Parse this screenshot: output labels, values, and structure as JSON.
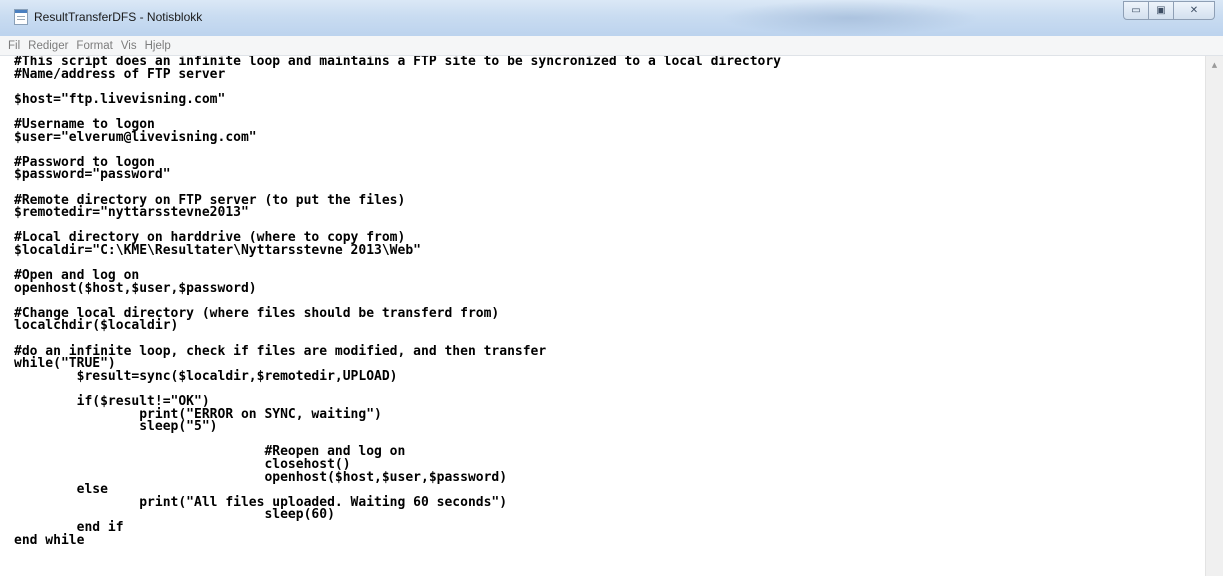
{
  "window": {
    "title": "ResultTransferDFS - Notisblokk",
    "controls": {
      "minimize": "▭",
      "maximize": "▣",
      "close": "✕"
    }
  },
  "menu": [
    "Fil",
    "Rediger",
    "Format",
    "Vis",
    "Hjelp"
  ],
  "editor": {
    "lines": [
      "#This script does an infinite loop and maintains a FTP site to be syncronized to a local directory",
      "#Name/address of FTP server",
      "",
      "$host=\"ftp.livevisning.com\"",
      "",
      "#Username to logon",
      "$user=\"elverum@livevisning.com\"",
      "",
      "#Password to logon",
      "$password=\"password\"",
      "",
      "#Remote directory on FTP server (to put the files)",
      "$remotedir=\"nyttarsstevne2013\"",
      "",
      "#Local directory on harddrive (where to copy from)",
      "$localdir=\"C:\\KME\\Resultater\\Nyttarsstevne 2013\\Web\"",
      "",
      "#Open and log on",
      "openhost($host,$user,$password)",
      "",
      "#Change local directory (where files should be transferd from)",
      "localchdir($localdir)",
      "",
      "#do an infinite loop, check if files are modified, and then transfer",
      "while(\"TRUE\")",
      "        $result=sync($localdir,$remotedir,UPLOAD)",
      "",
      "        if($result!=\"OK\")",
      "                print(\"ERROR on SYNC, waiting\")",
      "                sleep(\"5\")",
      "",
      "                                #Reopen and log on",
      "                                closehost()",
      "                                openhost($host,$user,$password)",
      "        else",
      "                print(\"All files uploaded. Waiting 60 seconds\")",
      "                                sleep(60)",
      "        end if",
      "end while"
    ]
  },
  "scrollbar": {
    "up_arrow": "▲"
  }
}
